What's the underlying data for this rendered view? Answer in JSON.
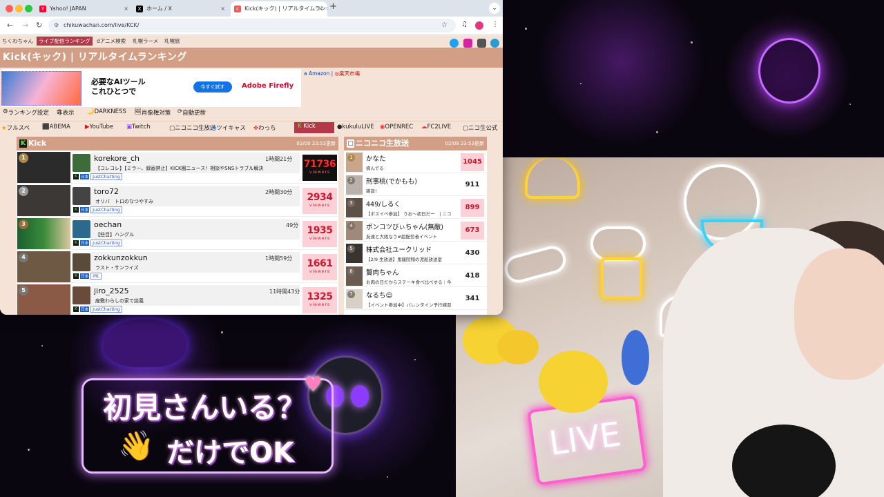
{
  "browser": {
    "tabs": [
      {
        "label": "Yahoo! JAPAN",
        "icon": "yahoo-icon"
      },
      {
        "label": "ホーム / X",
        "icon": "x-icon"
      },
      {
        "label": "Kick(キック) | リアルタイムランキ",
        "icon": "chikuwa-icon"
      }
    ],
    "url": "chikuwachan.com/live/KCK/",
    "profile_initial": "L"
  },
  "site": {
    "topnav": [
      "ちくわちゃん",
      "ライブ配信ランキング",
      "dアニメ検索",
      "札幌ラーメ",
      "札幌旅"
    ],
    "title": "Kick(キック) | リアルタイムランキング",
    "ad": {
      "headline1": "必要なAIツール",
      "headline2": "これひとつで",
      "button": "今すぐ試す",
      "brand": "Adobe Firefly"
    },
    "shops": {
      "amazon": "Amazon",
      "rakuten": "楽天市場"
    },
    "toolbar": [
      "ランキング設定",
      "非表示",
      "DARKNESS",
      "肖像権対策",
      "自動更新"
    ],
    "platforms": [
      "フルスペ",
      "ABEMA",
      "YouTube",
      "Twitch",
      "ニコニコ生放送",
      "ツイキャス",
      "わっち",
      "Kick",
      "kukuluLIVE",
      "OPENREC",
      "FC2LIVE",
      "ニコ生公式"
    ]
  },
  "kick": {
    "header": "Kick",
    "updated": "02/09 23:53更新",
    "rows": [
      {
        "rank": "1",
        "name": "korekore_ch",
        "desc": "【コレコレ】【ミラー、録画禁止】KICK圏ニュース！相談やSNSトラブル解決",
        "dur": "1時間21分",
        "viewers": "71736",
        "cat": "JustChatting"
      },
      {
        "rank": "2",
        "name": "toro72",
        "desc": "オリバ　トロのなつやすみ",
        "dur": "2時間30分",
        "viewers": "2934",
        "cat": "JustChatting"
      },
      {
        "rank": "3",
        "name": "oechan",
        "desc": "【些目】ハングル",
        "dur": "49分",
        "viewers": "1935",
        "cat": "JustChatting"
      },
      {
        "rank": "4",
        "name": "zokkunzokkun",
        "desc": "ラスト・サンライズ",
        "dur": "1時間59分",
        "viewers": "1661",
        "cat": "IRL"
      },
      {
        "rank": "5",
        "name": "jiro_2525",
        "desc": "座敷わらしの家で談義",
        "dur": "11時間43分",
        "viewers": "1325",
        "cat": "JustChatting"
      }
    ],
    "viewers_label": "viewers"
  },
  "nico": {
    "header": "ニコニコ生放送",
    "updated": "02/09 23:53更新",
    "rows": [
      {
        "rank": "1",
        "name": "かなた",
        "desc": "病んでる",
        "count": "1045"
      },
      {
        "rank": "2",
        "name": "刑事桃(でかもも)",
        "desc": "雑談!",
        "count": "911"
      },
      {
        "rank": "3",
        "name": "449/しるく",
        "desc": "【ボスイベ参加】 うお〜初日だー　| ニコ",
        "count": "899"
      },
      {
        "rank": "4",
        "name": "ポンコツびぃちゃん(無敵)",
        "desc": "友達と大阪なう#超配信者イベント",
        "count": "673"
      },
      {
        "rank": "5",
        "name": "株式会社ユークリッド",
        "desc": "【2/9 生放送】鬼龍院翔の泥船放送室",
        "count": "430"
      },
      {
        "rank": "6",
        "name": "贅肉ちゃん",
        "desc": "お肉の日だからステーキ食べ比べする｜今",
        "count": "418"
      },
      {
        "rank": "7",
        "name": "なるち☺",
        "desc": "【イベント参加中】バレンタイン予行練習",
        "count": "341"
      }
    ]
  },
  "overlay": {
    "line1": "初見さんいる？",
    "line2": "だけでOK",
    "hand_icon": "wave-hand-icon"
  },
  "webcam": {
    "sign": "LIVE"
  },
  "colors": {
    "accent": "#b2384a",
    "header": "#d29f86",
    "page_bg": "#f6e3d8",
    "viewer_red": "#c41a2f"
  }
}
